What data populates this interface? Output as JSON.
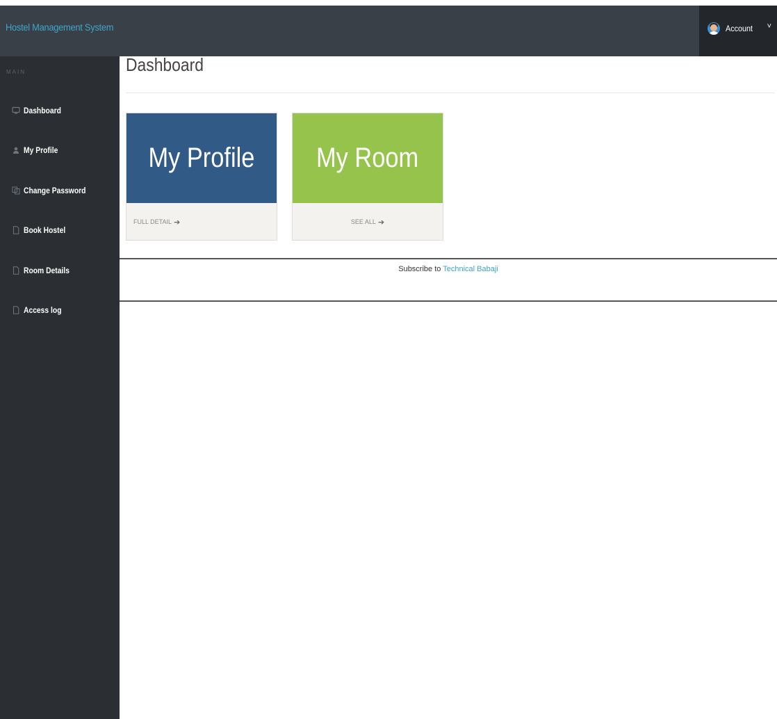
{
  "header": {
    "brand": "Hostel Management System",
    "account_label": "Account",
    "caret": "˅"
  },
  "sidebar": {
    "section_label": "MAIN",
    "items": [
      {
        "label": "Dashboard",
        "icon": "monitor-icon"
      },
      {
        "label": "My Profile",
        "icon": "user-icon"
      },
      {
        "label": "Change Password",
        "icon": "copy-icon"
      },
      {
        "label": "Book Hostel",
        "icon": "file-icon"
      },
      {
        "label": "Room Details",
        "icon": "file-icon"
      },
      {
        "label": "Access log",
        "icon": "file-icon"
      }
    ]
  },
  "main": {
    "title": "Dashboard",
    "cards": [
      {
        "title": "My Profile",
        "link": "FULL DETAIL",
        "arrow": "➔",
        "color": "#315b86"
      },
      {
        "title": "My Room",
        "link": "SEE ALL",
        "arrow": "➔",
        "color": "#95c34b"
      }
    ]
  },
  "footer": {
    "text": "Subscribe to ",
    "link": "Technical Babaji"
  },
  "colors": {
    "topbar": "#3a4047",
    "sidebar": "#2b2f34",
    "brand_text": "#3ea6c9",
    "link": "#3ea6c9"
  }
}
